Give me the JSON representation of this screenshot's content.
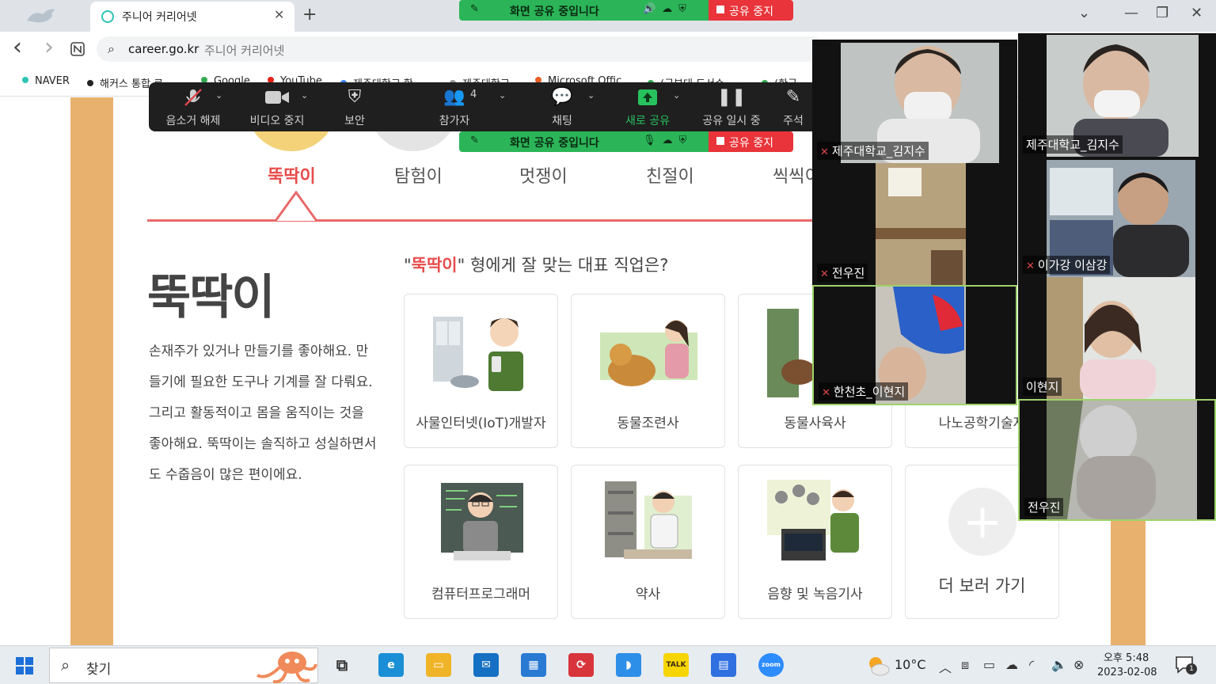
{
  "browser": {
    "tab_title": "주니어 커리어넷",
    "tab_close": "✕",
    "new_tab": "+",
    "window_controls": {
      "dropdown": "⌄",
      "minimize": "—",
      "restore": "❐",
      "close": "✕"
    },
    "back": "‹",
    "forward": "›",
    "address_domain": "career.go.kr",
    "address_rest": "주니어 커리어넷",
    "bookmarks": [
      {
        "label": "NAVER",
        "color": "#2ec4b6"
      },
      {
        "label": "해커스 통합 로",
        "color": "#222222"
      },
      {
        "label": "Google",
        "color": "#34a853"
      },
      {
        "label": "YouTube",
        "color": "#e62117"
      },
      {
        "label": "제주대학교 학",
        "color": "#3b82f6"
      },
      {
        "label": "제주대학교",
        "color": "#999999"
      },
      {
        "label": "Microsoft Offic",
        "color": "#e85d25"
      },
      {
        "label": "(국부대 도서수",
        "color": "#2fa84f"
      },
      {
        "label": "(한국",
        "color": "#2fa84f"
      }
    ]
  },
  "page": {
    "categories": [
      "뚝딱이",
      "탐험이",
      "멋쟁이",
      "친절이",
      "씩씩이"
    ],
    "big_title": "뚝딱이",
    "description": "손재주가 있거나 만들기를 좋아해요. 만들기에 필요한 도구나 기계를 잘 다뤄요. 그리고 활동적이고 몸을 움직이는 것을 좋아해요. 뚝딱이는 솔직하고 성실하면서도 수줍음이 많은 편이에요.",
    "question_prefix": "\"",
    "question_highlight": "뚝딱이",
    "question_suffix": "\" 형에게 잘 맞는 대표 직업은?",
    "jobs": [
      {
        "label": "사물인터넷(IoT)개발자"
      },
      {
        "label": "동물조련사"
      },
      {
        "label": "동물사육사"
      },
      {
        "label": "나노공학기술자"
      },
      {
        "label": "컴퓨터프로그래머"
      },
      {
        "label": "약사"
      },
      {
        "label": "음향 및 녹음기사"
      }
    ],
    "more_label": "더 보러 가기",
    "more_plus": "+"
  },
  "zoom": {
    "share_text": "화면 공유 중입니다",
    "stop_share": "공유 중지",
    "toolbar": [
      {
        "icon": "🎙",
        "label": "음소거 해제",
        "badge": ""
      },
      {
        "icon": "■",
        "label": "비디오 중지",
        "badge": ""
      },
      {
        "icon": "⛨",
        "label": "보안",
        "badge": ""
      },
      {
        "icon": "👥",
        "label": "참가자",
        "badge": "4"
      },
      {
        "icon": "💬",
        "label": "채팅",
        "badge": ""
      },
      {
        "icon": "⬆",
        "label": "새로 공유",
        "badge": ""
      },
      {
        "icon": "❚❚",
        "label": "공유 일시 중",
        "badge": ""
      },
      {
        "icon": "✎",
        "label": "주석",
        "badge": ""
      }
    ],
    "caret": "⌄",
    "participants": [
      {
        "name": "제주대학교_김지수",
        "muted": true
      },
      {
        "name": "전우진",
        "muted": true
      },
      {
        "name": "한천초_이현지",
        "muted": true
      },
      {
        "name": "제주대학교_김지수",
        "muted": false
      },
      {
        "name": "이가강 이삼강",
        "muted": true
      },
      {
        "name": "이현지",
        "muted": false
      },
      {
        "name": "전우진",
        "muted": false
      }
    ]
  },
  "taskbar": {
    "search_placeholder": "찾기",
    "temperature": "10°C",
    "time": "오후 5:48",
    "date": "2023-02-08",
    "notification_count": "1",
    "apps": [
      {
        "name": "task-view",
        "glyph": "⧉",
        "color": "#5a5a5a"
      },
      {
        "name": "edge",
        "glyph": "e",
        "color": "#1b8fd6"
      },
      {
        "name": "explorer",
        "glyph": "▭",
        "color": "#f0b429"
      },
      {
        "name": "mail",
        "glyph": "✉",
        "color": "#1570c4"
      },
      {
        "name": "store",
        "glyph": "▦",
        "color": "#2a7ad3"
      },
      {
        "name": "sync",
        "glyph": "⟳",
        "color": "#d8343c"
      },
      {
        "name": "whale",
        "glyph": "◗",
        "color": "#2d8fe8"
      },
      {
        "name": "kakaotalk",
        "glyph": "TALK",
        "color": "#f7d500"
      },
      {
        "name": "docs",
        "glyph": "▤",
        "color": "#2f6fe0"
      },
      {
        "name": "zoom",
        "glyph": "zoom",
        "color": "#2d8cff"
      }
    ]
  }
}
